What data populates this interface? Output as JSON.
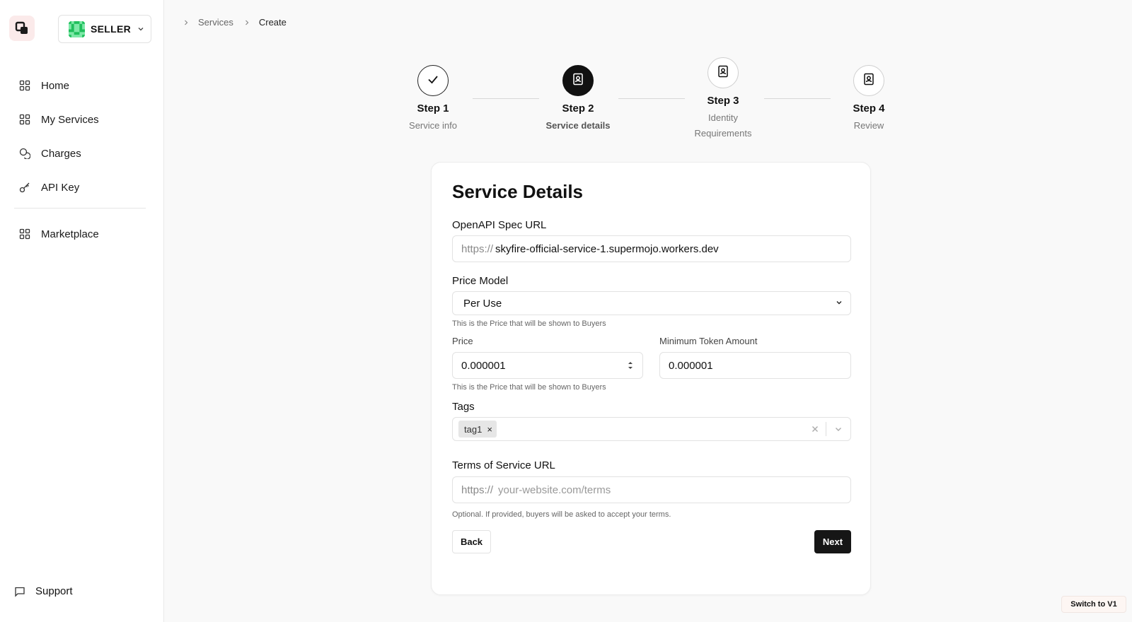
{
  "sidebar": {
    "role": "SELLER",
    "items": [
      {
        "label": "Home",
        "icon": "grid-icon"
      },
      {
        "label": "My Services",
        "icon": "grid-icon"
      },
      {
        "label": "Charges",
        "icon": "coins-icon"
      },
      {
        "label": "API Key",
        "icon": "key-icon"
      },
      {
        "label": "Marketplace",
        "icon": "grid-icon"
      }
    ],
    "support": "Support"
  },
  "breadcrumb": {
    "items": [
      "Services",
      "Create"
    ]
  },
  "steps": [
    {
      "title": "Step 1",
      "subtitle": "Service info",
      "status": "complete"
    },
    {
      "title": "Step 2",
      "subtitle": "Service details",
      "status": "active"
    },
    {
      "title": "Step 3",
      "subtitle_line1": "Identity",
      "subtitle_line2": "Requirements",
      "status": "pending"
    },
    {
      "title": "Step 4",
      "subtitle": "Review",
      "status": "pending"
    }
  ],
  "form": {
    "title": "Service Details",
    "openapi": {
      "label": "OpenAPI Spec URL",
      "prefix": "https://",
      "value": "skyfire-official-service-1.supermojo.workers.dev"
    },
    "price_model": {
      "label": "Price Model",
      "value": "Per Use",
      "hint": "This is the Price that will be shown to Buyers"
    },
    "price": {
      "label": "Price",
      "value": "0.000001",
      "hint": "This is the Price that will be shown to Buyers"
    },
    "min_token": {
      "label": "Minimum Token Amount",
      "value": "0.000001"
    },
    "tags": {
      "label": "Tags",
      "values": [
        "tag1"
      ],
      "remove": "×"
    },
    "tos": {
      "label": "Terms of Service URL",
      "prefix": "https://",
      "placeholder": "your-website.com/terms",
      "hint": "Optional. If provided, buyers will be asked to accept your terms."
    },
    "back_label": "Back",
    "next_label": "Next"
  },
  "footer": {
    "switch_label": "Switch to V1"
  },
  "colors": {
    "accent": "#161616",
    "logo_bg": "#fbeaea",
    "avatar_green": "#2ecc71"
  }
}
